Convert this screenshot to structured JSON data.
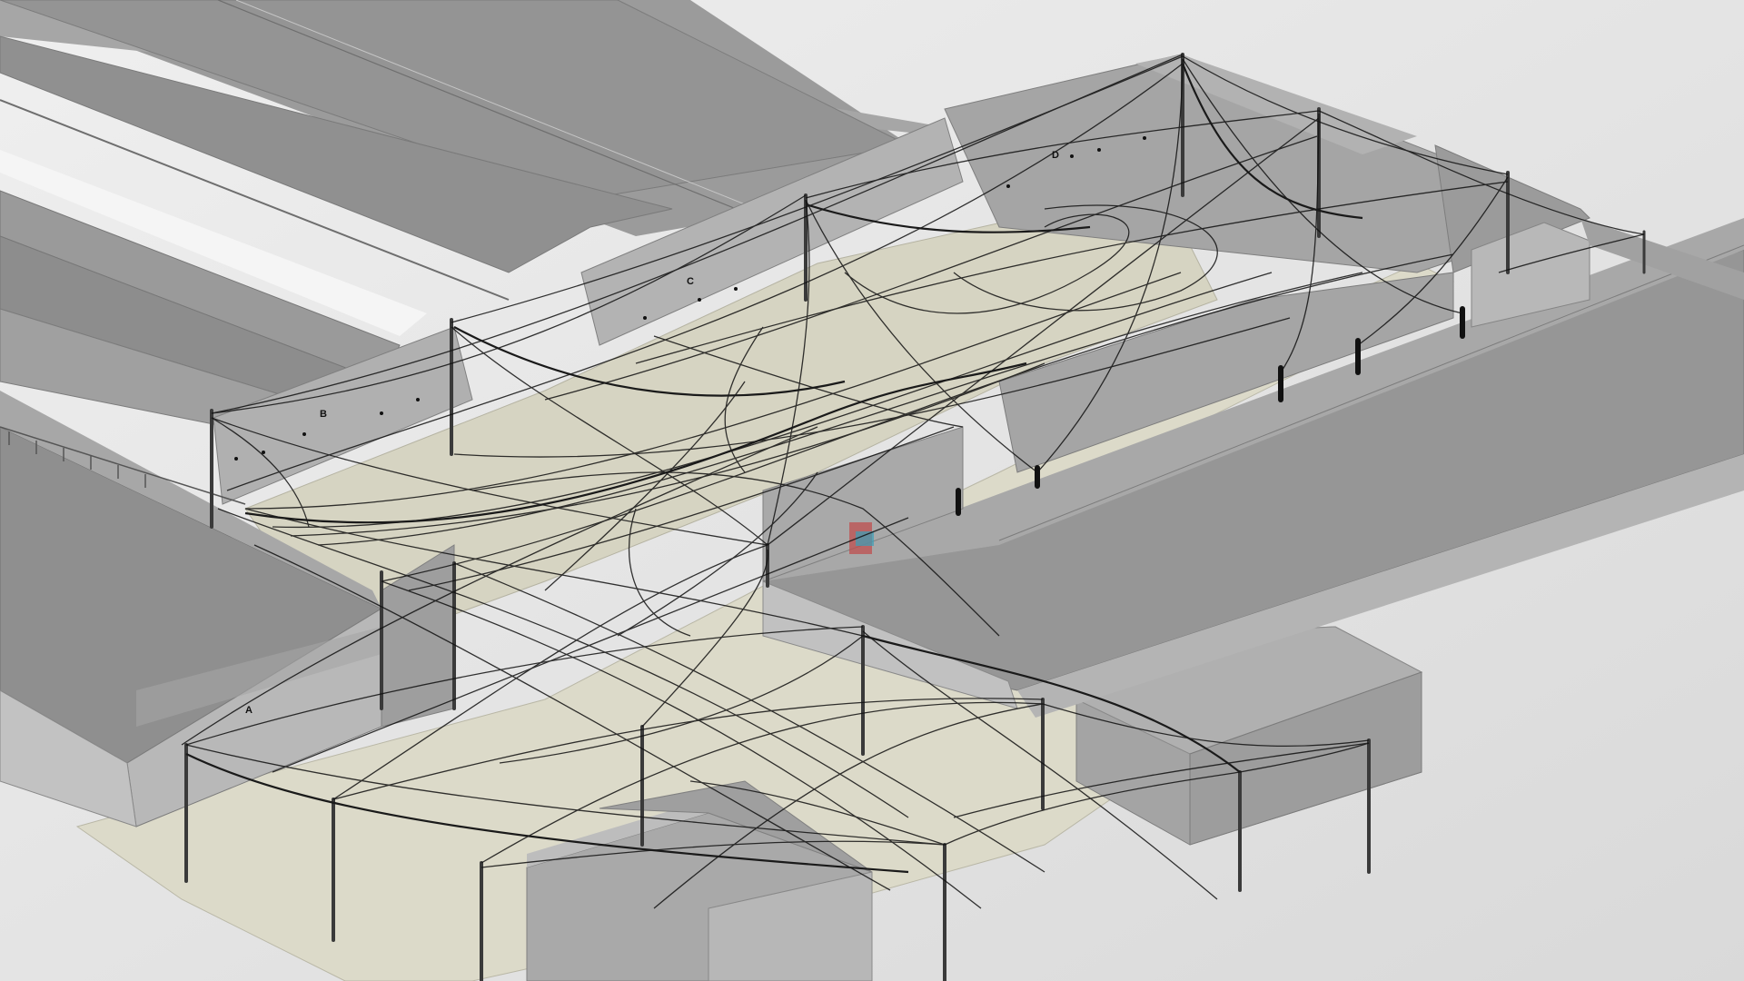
{
  "scene": {
    "colors": {
      "background": "#e6e6e6",
      "roof_dark": "#8f8f8f",
      "roof_mid": "#a3a3a3",
      "roof_light": "#b4b4b4",
      "wall": "#bdbdbd",
      "ground": "#dcdac9",
      "cable": "#111111"
    },
    "labels": {
      "hall_a": "A",
      "hall_b": "B",
      "hall_c": "C",
      "hall_d": "D"
    }
  }
}
